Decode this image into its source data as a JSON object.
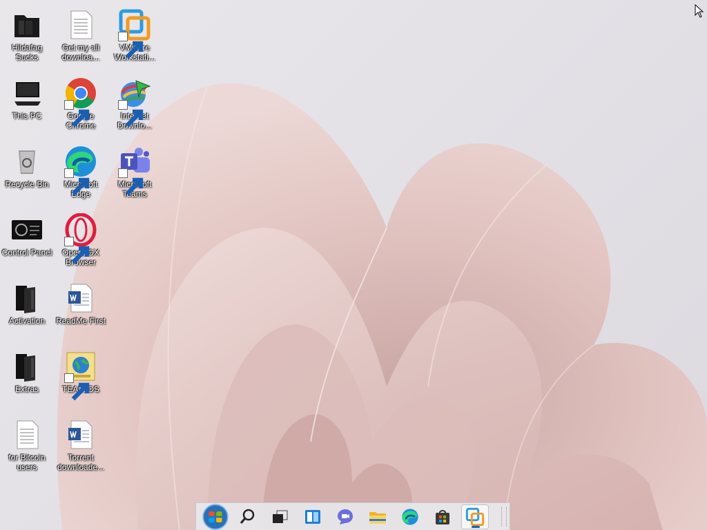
{
  "desktop": {
    "icons": [
      {
        "label": "Hildafag\nSucks",
        "icon": "folder-icon"
      },
      {
        "label": "This PC",
        "icon": "computer-icon"
      },
      {
        "label": "Recycle Bin",
        "icon": "recycle-bin-icon"
      },
      {
        "label": "Control Panel",
        "icon": "control-panel-icon"
      },
      {
        "label": "Activation",
        "icon": "folder-icon"
      },
      {
        "label": "Extras",
        "icon": "folder-icon"
      },
      {
        "label": "for Bitcoin\nusers",
        "icon": "text-file-icon"
      },
      {
        "label": "Get my all\ndownloa...",
        "icon": "text-file-icon"
      },
      {
        "label": "Google\nChrome",
        "icon": "chrome-icon"
      },
      {
        "label": "Microsoft\nEdge",
        "icon": "edge-icon"
      },
      {
        "label": "Opera GX\nBrowser",
        "icon": "opera-gx-icon"
      },
      {
        "label": "ReadMe First",
        "icon": "word-doc-icon"
      },
      {
        "label": "TEAM OS",
        "icon": "internet-shortcut-icon"
      },
      {
        "label": "Torrent\ndownloade...",
        "icon": "word-doc-icon"
      },
      {
        "label": "VMware\nWorkstati...",
        "icon": "vmware-icon"
      },
      {
        "label": "Internet\nDownlo...",
        "icon": "idm-icon"
      },
      {
        "label": "Microsoft\nTeams",
        "icon": "teams-icon"
      }
    ]
  },
  "taskbar": {
    "items": [
      {
        "name": "start-button",
        "icon": "windows-start-icon"
      },
      {
        "name": "search-button",
        "icon": "search-icon"
      },
      {
        "name": "task-view-button",
        "icon": "task-view-icon"
      },
      {
        "name": "widgets-button",
        "icon": "widgets-icon"
      },
      {
        "name": "teams-chat-button",
        "icon": "chat-icon"
      },
      {
        "name": "file-explorer-button",
        "icon": "file-explorer-icon"
      },
      {
        "name": "edge-button",
        "icon": "edge-icon"
      },
      {
        "name": "store-button",
        "icon": "store-icon"
      },
      {
        "name": "vmware-button",
        "icon": "vmware-icon",
        "active": true
      }
    ]
  },
  "colors": {
    "accent": "#0a64c8",
    "wallpaper_petal": "#e8cfcc",
    "wallpaper_petal_shadow": "#d7b8b5"
  }
}
